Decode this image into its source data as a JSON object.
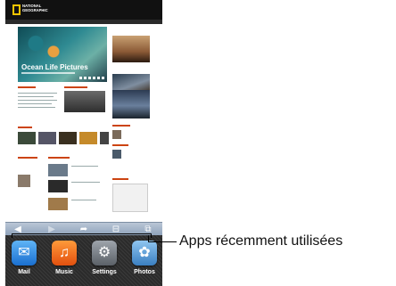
{
  "website": {
    "brand_line1": "NATIONAL",
    "brand_line2": "GEOGRAPHIC",
    "hero_title": "Ocean Life Pictures"
  },
  "toolbar": {
    "back_icon": "◀",
    "forward_icon": "▶",
    "share_icon": "➦",
    "bookmarks_icon": "⊟",
    "tabs_icon": "⧉"
  },
  "recent_apps": [
    {
      "label": "Mail",
      "icon": "mail-icon",
      "glyph": "✉"
    },
    {
      "label": "Music",
      "icon": "music-icon",
      "glyph": "♫"
    },
    {
      "label": "Settings",
      "icon": "settings-icon",
      "glyph": "⚙"
    },
    {
      "label": "Photos",
      "icon": "photos-icon",
      "glyph": "✿"
    }
  ],
  "callout": {
    "label": "Apps récemment utilisées"
  }
}
